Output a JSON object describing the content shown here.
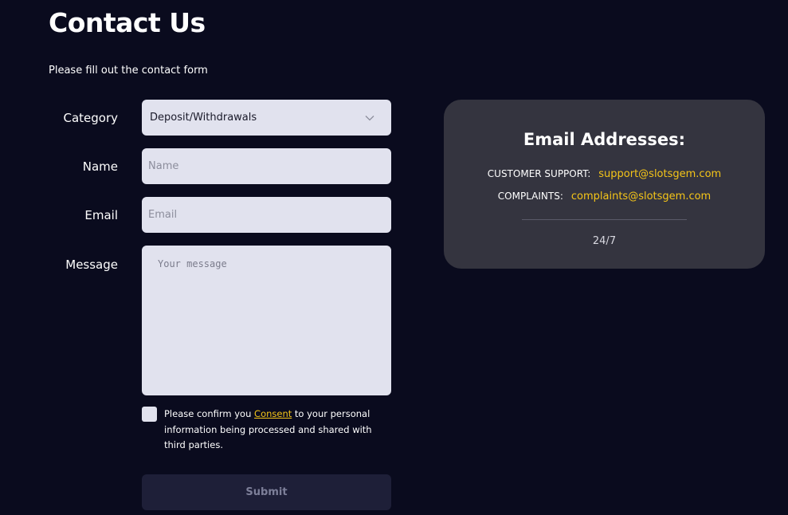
{
  "header": {
    "title": "Contact Us",
    "subtitle": "Please fill out the contact form"
  },
  "form": {
    "category": {
      "label": "Category",
      "value": "Deposit/Withdrawals"
    },
    "name": {
      "label": "Name",
      "placeholder": "Name",
      "value": ""
    },
    "email": {
      "label": "Email",
      "placeholder": "Email",
      "value": ""
    },
    "message": {
      "label": "Message",
      "placeholder": "Your message",
      "value": ""
    },
    "consent": {
      "checked": false,
      "text_before": "Please confirm you ",
      "link_text": "Consent",
      "text_after": " to your personal information being processed and shared with third parties."
    },
    "submit_label": "Submit"
  },
  "info_card": {
    "title": "Email Addresses:",
    "contacts": [
      {
        "label": "CUSTOMER SUPPORT:",
        "email": "support@slotsgem.com"
      },
      {
        "label": "COMPLAINTS:",
        "email": "complaints@slotsgem.com"
      }
    ],
    "hours": "24/7"
  },
  "colors": {
    "background": "#0a0b1e",
    "field_bg": "#e1e2ee",
    "card_bg": "#34343f",
    "accent": "#f5c518",
    "button_bg": "#1e1f38",
    "button_text": "#7d7f99"
  },
  "icons": {
    "category_dropdown": "chevron-down-icon"
  }
}
